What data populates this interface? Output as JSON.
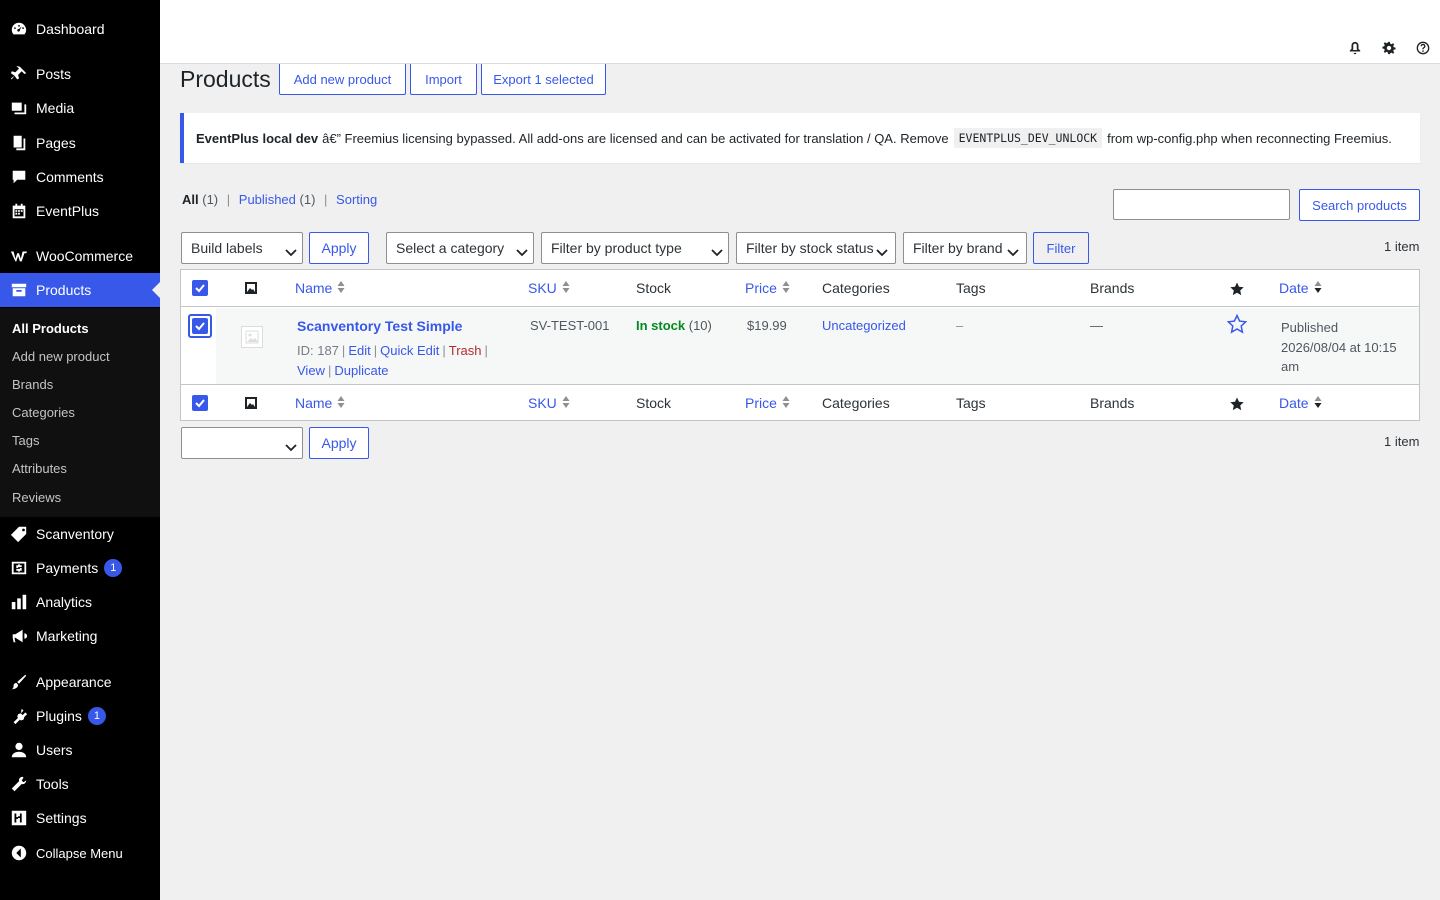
{
  "sidebar": {
    "items": [
      {
        "label": "Dashboard",
        "icon": "dashboard-icon"
      },
      {
        "label": "Posts",
        "icon": "pin-icon"
      },
      {
        "label": "Media",
        "icon": "media-icon"
      },
      {
        "label": "Pages",
        "icon": "pages-icon"
      },
      {
        "label": "Comments",
        "icon": "comment-icon"
      },
      {
        "label": "EventPlus",
        "icon": "calendar-icon"
      },
      {
        "label": "WooCommerce",
        "icon": "woo-icon"
      },
      {
        "label": "Products",
        "icon": "archive-icon"
      },
      {
        "label": "Scanventory",
        "icon": "tag-icon"
      },
      {
        "label": "Payments",
        "icon": "dollar-icon",
        "badge": "1"
      },
      {
        "label": "Analytics",
        "icon": "chart-icon"
      },
      {
        "label": "Marketing",
        "icon": "megaphone-icon"
      },
      {
        "label": "Appearance",
        "icon": "brush-icon"
      },
      {
        "label": "Plugins",
        "icon": "plugin-icon",
        "badge": "1"
      },
      {
        "label": "Users",
        "icon": "user-icon"
      },
      {
        "label": "Tools",
        "icon": "wrench-icon"
      },
      {
        "label": "Settings",
        "icon": "settings-icon"
      },
      {
        "label": "Collapse Menu",
        "icon": "collapse-icon"
      }
    ],
    "submenu": [
      "All Products",
      "Add new product",
      "Brands",
      "Categories",
      "Tags",
      "Attributes",
      "Reviews"
    ]
  },
  "header": {
    "title": "Products",
    "add_new": "Add new product",
    "import": "Import",
    "export": "Export 1 selected"
  },
  "notice": {
    "bold": "EventPlus local dev",
    "text1": "â€” Freemius licensing bypassed. All add-ons are licensed and can be activated for translation / QA. Remove",
    "code": "EVENTPLUS_DEV_UNLOCK",
    "text2": "from wp-config.php when reconnecting Freemius."
  },
  "views": {
    "all": "All",
    "all_count": "(1)",
    "published": "Published",
    "published_count": "(1)",
    "sorting": "Sorting"
  },
  "search": {
    "button": "Search products",
    "value": ""
  },
  "filters": {
    "bulk_action": "Build labels",
    "apply": "Apply",
    "category": "Select a category",
    "product_type": "Filter by product type",
    "stock_status": "Filter by stock status",
    "brand": "Filter by brand",
    "filter_button": "Filter",
    "items_count": "1 item",
    "bottom_bulk_action": "",
    "bottom_apply": "Apply",
    "bottom_items_count": "1 item"
  },
  "table": {
    "columns": {
      "name": "Name",
      "sku": "SKU",
      "stock": "Stock",
      "price": "Price",
      "categories": "Categories",
      "tags": "Tags",
      "brands": "Brands",
      "date": "Date"
    },
    "rows": [
      {
        "name": "Scanventory Test Simple",
        "id_label": "ID: 187",
        "edit": "Edit",
        "quick_edit": "Quick Edit",
        "trash": "Trash",
        "view": "View",
        "duplicate": "Duplicate",
        "sku": "SV-TEST-001",
        "stock_status": "In stock",
        "stock_qty": "(10)",
        "price": "$19.99",
        "category": "Uncategorized",
        "tags": "–",
        "brands": "—",
        "date_status": "Published",
        "date_value": "2026/08/04 at 10:15 am"
      }
    ]
  },
  "colors": {
    "accent": "#3858e9",
    "sidebar_bg": "#000000",
    "instock": "#008a20",
    "trash": "#b32d2e"
  }
}
